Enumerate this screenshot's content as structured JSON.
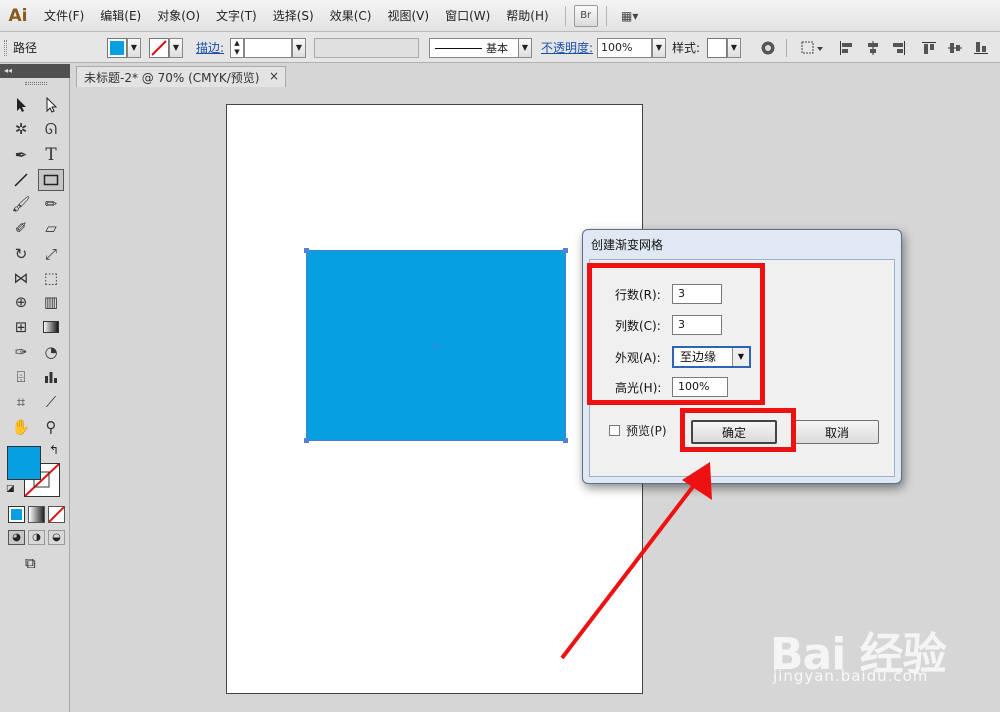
{
  "app": {
    "logo": "Ai"
  },
  "menu": {
    "items": [
      "文件(F)",
      "编辑(E)",
      "对象(O)",
      "文字(T)",
      "选择(S)",
      "效果(C)",
      "视图(V)",
      "窗口(W)",
      "帮助(H)"
    ],
    "bridge_label": "Br",
    "workspace_label": "▦▾"
  },
  "control_bar": {
    "selection_type": "路径",
    "fill_color": "#069fe2",
    "stroke_label": "描边:",
    "stroke_style": "基本",
    "opacity_label": "不透明度:",
    "opacity_value": "100%",
    "style_label": "样式:"
  },
  "document": {
    "tab_title": "未标题-2* @ 70% (CMYK/预览)",
    "close_glyph": "×",
    "shape_fill": "#069fe2"
  },
  "toolbox": {
    "collapse_glyph": "◂◂",
    "fill_color": "#069fe2"
  },
  "dialog": {
    "title": "创建渐变网格",
    "rows_label": "行数(R):",
    "rows_value": "3",
    "cols_label": "列数(C):",
    "cols_value": "3",
    "appearance_label": "外观(A):",
    "appearance_value": "至边缘",
    "highlight_label": "高光(H):",
    "highlight_value": "100%",
    "preview_label": "预览(P)",
    "ok_label": "确定",
    "cancel_label": "取消"
  },
  "annotation": {
    "color": "#ee1111"
  },
  "watermark": {
    "text": "Bai 经验",
    "url": "jingyan.baidu.com"
  }
}
